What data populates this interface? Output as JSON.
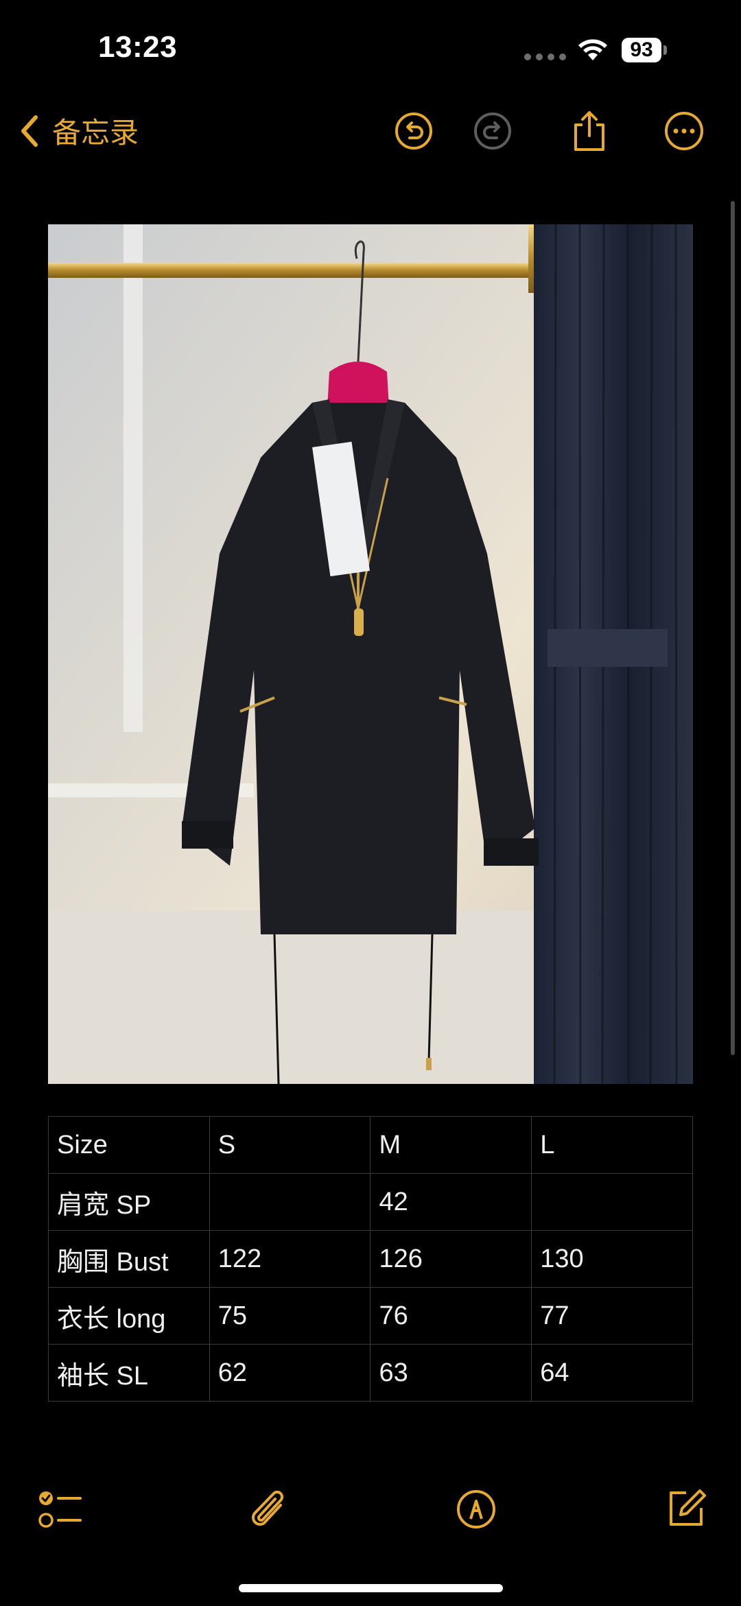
{
  "status_bar": {
    "time": "13:23",
    "battery": "93"
  },
  "nav": {
    "back_label": "备忘录",
    "accent_color": "#e7a92f"
  },
  "note": {
    "photo_alt": "black zip jacket on red hanger",
    "size_table": {
      "rows": [
        [
          "Size",
          "S",
          "M",
          "L"
        ],
        [
          "肩宽 SP",
          "",
          "42",
          ""
        ],
        [
          "胸围 Bust",
          "122",
          "126",
          "130"
        ],
        [
          "衣长 long",
          "75",
          "76",
          "77"
        ],
        [
          "袖长 SL",
          "62",
          "63",
          "64"
        ]
      ]
    }
  },
  "toolbar": {
    "icons": [
      "checklist-icon",
      "attachment-icon",
      "markup-icon",
      "compose-icon"
    ]
  }
}
